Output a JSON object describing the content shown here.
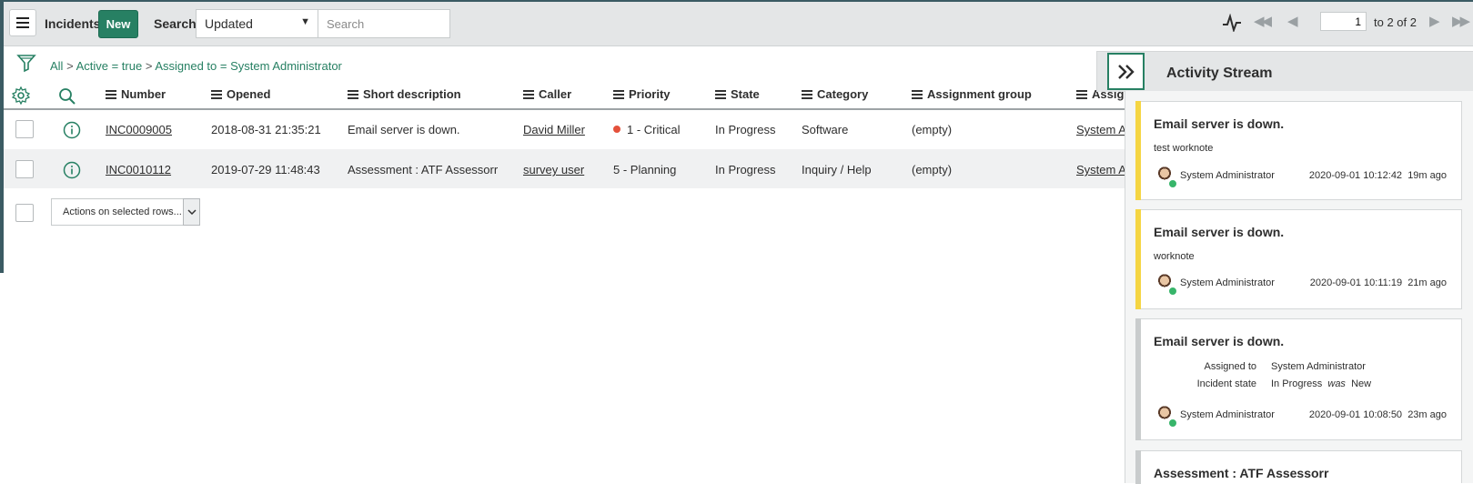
{
  "header": {
    "title": "Incidents",
    "new_label": "New",
    "search_label": "Search",
    "search_field_selected": "Updated",
    "search_placeholder": "Search",
    "page_current": "1",
    "page_of": "to 2 of 2"
  },
  "breadcrumb": {
    "all": "All",
    "sep": ">",
    "crumbs": [
      "Active = true",
      "Assigned to = System Administrator"
    ]
  },
  "columns": [
    "Number",
    "Opened",
    "Short description",
    "Caller",
    "Priority",
    "State",
    "Category",
    "Assignment group",
    "Assigned"
  ],
  "rows": [
    {
      "number": "INC0009005",
      "opened": "2018-08-31 21:35:21",
      "short_description": "Email server is down.",
      "caller": "David Miller",
      "priority": "1 - Critical",
      "state": "In Progress",
      "category": "Software",
      "assignment_group": "(empty)",
      "assigned_to": "System Ad"
    },
    {
      "number": "INC0010112",
      "opened": "2019-07-29 11:48:43",
      "short_description": "Assessment : ATF Assessorr",
      "caller": "survey user",
      "priority": "5 - Planning",
      "state": "In Progress",
      "category": "Inquiry / Help",
      "assignment_group": "(empty)",
      "assigned_to": "System Ad"
    }
  ],
  "actions_label": "Actions on selected rows...",
  "activity": {
    "title": "Activity Stream",
    "cards": [
      {
        "title": "Email server is down.",
        "note": "test worknote",
        "author": "System Administrator",
        "timestamp": "2020-09-01 10:12:42",
        "ago": "19m ago",
        "bar_color": "#f5d542"
      },
      {
        "title": "Email server is down.",
        "note": "worknote",
        "author": "System Administrator",
        "timestamp": "2020-09-01 10:11:19",
        "ago": "21m ago",
        "bar_color": "#f5d542"
      },
      {
        "title": "Email server is down.",
        "fields": [
          {
            "label": "Assigned to",
            "value": "System Administrator"
          },
          {
            "label": "Incident state",
            "value": "In Progress",
            "was_word": "was",
            "was_value": "New"
          }
        ],
        "author": "System Administrator",
        "timestamp": "2020-09-01 10:08:50",
        "ago": "23m ago",
        "bar_color": "#c9cccd"
      },
      {
        "title": "Assessment : ATF Assessorr",
        "bar_color": "#c9cccd"
      }
    ]
  },
  "colors": {
    "accent": "#278063",
    "header_bg": "#e4e6e7",
    "critical": "#e4513b"
  }
}
